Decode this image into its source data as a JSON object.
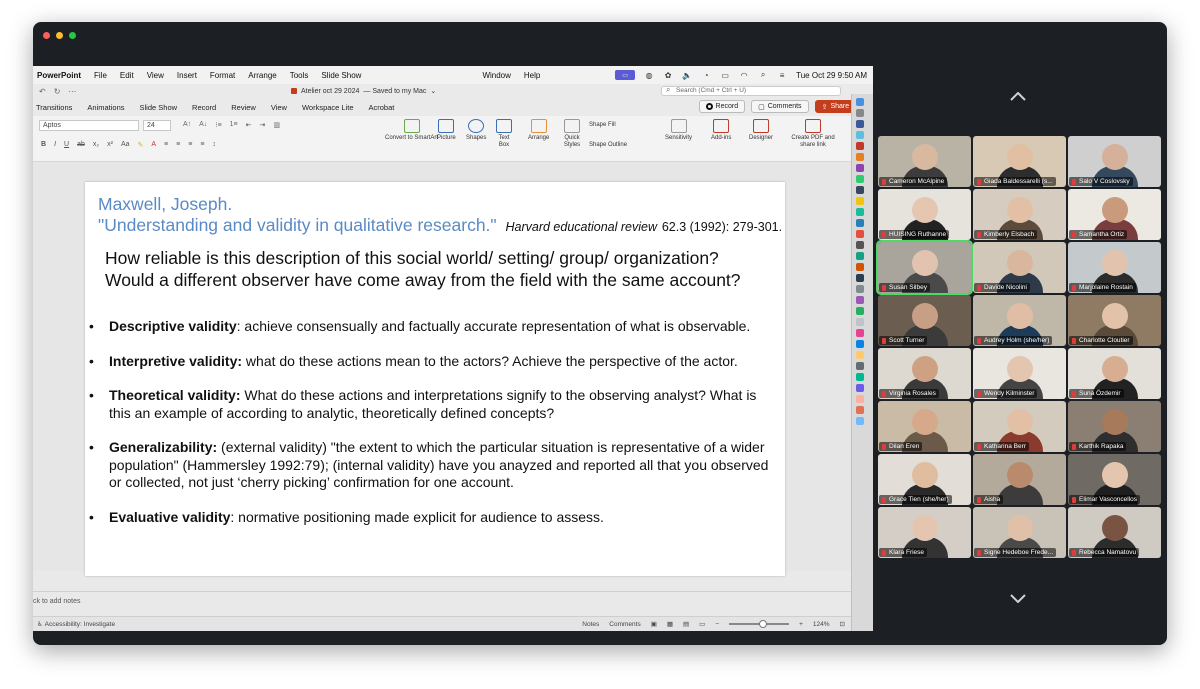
{
  "menubar": {
    "app": "PowerPoint",
    "items": [
      "File",
      "Edit",
      "View",
      "Insert",
      "Format",
      "Arrange",
      "Tools",
      "Slide Show",
      "Window",
      "Help"
    ],
    "datetime": "Tue Oct 29  9:50 AM"
  },
  "titlebar": {
    "doc_title": "Atelier oct 29 2024",
    "saved": "— Saved to my Mac",
    "search_placeholder": "Search (Cmd + Ctrl + U)"
  },
  "ribbon": {
    "tabs": [
      "Transitions",
      "Animations",
      "Slide Show",
      "Record",
      "Review",
      "View",
      "Workspace Lite",
      "Acrobat"
    ],
    "record_label": "Record",
    "comments_label": "Comments",
    "share_label": "Share",
    "font_name": "Aptos",
    "font_size": "24",
    "groups": {
      "convert": "Convert to SmartArt",
      "picture": "Picture",
      "shapes": "Shapes",
      "textbox": "Text Box",
      "arrange": "Arrange",
      "quick_styles": "Quick Styles",
      "shape_fill": "Shape Fill",
      "shape_outline": "Shape Outline",
      "sensitivity": "Sensitivity",
      "addins": "Add-ins",
      "designer": "Designer",
      "create_pdf": "Create PDF and share link"
    }
  },
  "slide": {
    "ref_author": "Maxwell, Joseph.",
    "ref_title": "\"Understanding and validity in qualitative research.\"",
    "ref_journal": "Harvard educational review",
    "ref_pages": "62.3 (1992): 279-301.",
    "question1": "How reliable is this description of this social world/ setting/ group/ organization?",
    "question2": "Would a different observer have come away from the field with the same account?",
    "bullets": [
      {
        "term": "Descriptive validity",
        "text": ": achieve consensually and factually accurate representation of what is observable."
      },
      {
        "term": "Interpretive validity:",
        "text": "  what do these actions mean to the actors? Achieve the perspective of the actor."
      },
      {
        "term": "Theoretical validity:",
        "text": " What do these actions and interpretations signify to the observing analyst? What is this an example of according to analytic, theoretically defined concepts?"
      },
      {
        "term": "Generalizability:",
        "text": " (external validity) \"the extent to which the particular situation is representative of a wider population\" (Hammersley 1992:79); (internal validity) have you anayzed and reported all that you observed or collected, not just ‘cherry picking’ confirmation for one account."
      },
      {
        "term": "Evaluative validity",
        "text": ": normative positioning made explicit for audience to assess."
      }
    ]
  },
  "notes_placeholder": "ck to add notes",
  "statusbar": {
    "accessibility": "Accessibility: Investigate",
    "notes": "Notes",
    "comments": "Comments",
    "zoom": "124%"
  },
  "participants": [
    {
      "name": "Cameron McAlpine",
      "bg": "#b9b3a6",
      "skin": "#d9b8a0",
      "shirt": "#3c3c3c"
    },
    {
      "name": "Giada Baldessarelli (s...",
      "bg": "#d8c9b4",
      "skin": "#e0bfa3",
      "shirt": "#2d2d2d"
    },
    {
      "name": "Salo V Coslovsky",
      "bg": "#cfcfcf",
      "skin": "#d5b09a",
      "shirt": "#34495e"
    },
    {
      "name": "HUISING Ruthanne",
      "bg": "#e6e2dc",
      "skin": "#e4c6b1",
      "shirt": "#222222"
    },
    {
      "name": "Kimberly Elsbach",
      "bg": "#d6ccbf",
      "skin": "#e2c0a6",
      "shirt": "#5c4b3b"
    },
    {
      "name": "Samantha Ortiz",
      "bg": "#ece8e2",
      "skin": "#c99a7b",
      "shirt": "#7a3d3d"
    },
    {
      "name": "Susan Silbey",
      "bg": "#a9a49c",
      "skin": "#e1c3b0",
      "shirt": "#4a4a4a"
    },
    {
      "name": "Davide Nicolini",
      "bg": "#d1c8ba",
      "skin": "#d9b79f",
      "shirt": "#2f3a48"
    },
    {
      "name": "Marjolaine Rostain",
      "bg": "#c4c9cc",
      "skin": "#e2c3ad",
      "shirt": "#2b2b2b"
    },
    {
      "name": "Scott Turner",
      "bg": "#6b5d4f",
      "skin": "#c79f84",
      "shirt": "#3b3b3b"
    },
    {
      "name": "Audrey Holm (she/her)",
      "bg": "#bfb8a8",
      "skin": "#e0bea5",
      "shirt": "#1f3b5a"
    },
    {
      "name": "Charlotte Cloutier",
      "bg": "#8f7b63",
      "skin": "#e2c2a8",
      "shirt": "#5a4a3a"
    },
    {
      "name": "Virginia Rosales",
      "bg": "#ddd8d0",
      "skin": "#cfa183",
      "shirt": "#3a3a3a"
    },
    {
      "name": "Wendy Kilminster",
      "bg": "#e9e5df",
      "skin": "#e3c5b0",
      "shirt": "#444444"
    },
    {
      "name": "Suna Özdemir",
      "bg": "#e3dfd9",
      "skin": "#d7ae92",
      "shirt": "#222222"
    },
    {
      "name": "Dilan Eren",
      "bg": "#c9bba6",
      "skin": "#d6a98a",
      "shirt": "#6b5a4a"
    },
    {
      "name": "Katharina Berr",
      "bg": "#d3cbbe",
      "skin": "#e2c0a6",
      "shirt": "#8a3b2e"
    },
    {
      "name": "Karthik Rapaka",
      "bg": "#8a7f72",
      "skin": "#a87a5c",
      "shirt": "#2e2e2e"
    },
    {
      "name": "Grace Tien (she/her)",
      "bg": "#e2ddd6",
      "skin": "#e1bd9f",
      "shirt": "#2a2a2a"
    },
    {
      "name": "Aisha",
      "bg": "#b4aa9c",
      "skin": "#b98a6c",
      "shirt": "#3c3c3c"
    },
    {
      "name": "Elimar Vasconcellos",
      "bg": "#6f6a63",
      "skin": "#e4c5ae",
      "shirt": "#1e1e1e"
    },
    {
      "name": "Klara Friese",
      "bg": "#d4cec6",
      "skin": "#e4c6b0",
      "shirt": "#333333"
    },
    {
      "name": "Signe Hedeboe Frede...",
      "bg": "#c9c2b7",
      "skin": "#e0c0a8",
      "shirt": "#4a4a4a"
    },
    {
      "name": "Rebecca Namatovu",
      "bg": "#cfcac2",
      "skin": "#7a5443",
      "shirt": "#2c2c2c"
    }
  ],
  "active_speaker": "Susan Silbey"
}
